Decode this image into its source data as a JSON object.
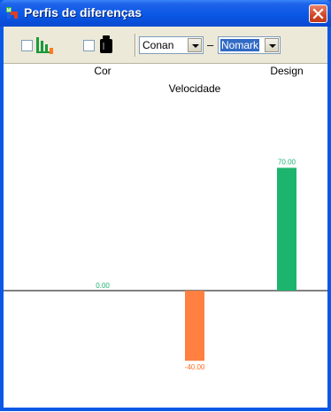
{
  "window": {
    "title": "Perfis de diferenças"
  },
  "toolbar": {
    "checkbox1_checked": false,
    "checkbox2_checked": false,
    "icon1": "bar-chart-icon",
    "icon2": "weight-icon",
    "combo1_value": "Conan",
    "separator": "–",
    "combo2_value": "Nomark"
  },
  "colors": {
    "positive": "#1DB46E",
    "negative": "#FF8040",
    "positive_label": "#1DB46E",
    "negative_label": "#FF6A20"
  },
  "chart_data": {
    "type": "bar",
    "categories": [
      "Cor",
      "Velocidade",
      "Design"
    ],
    "values": [
      0.0,
      -40.0,
      70.0
    ],
    "value_labels": [
      "0.00",
      "-40.00",
      "70.00"
    ],
    "ylim": [
      -40,
      70
    ]
  }
}
